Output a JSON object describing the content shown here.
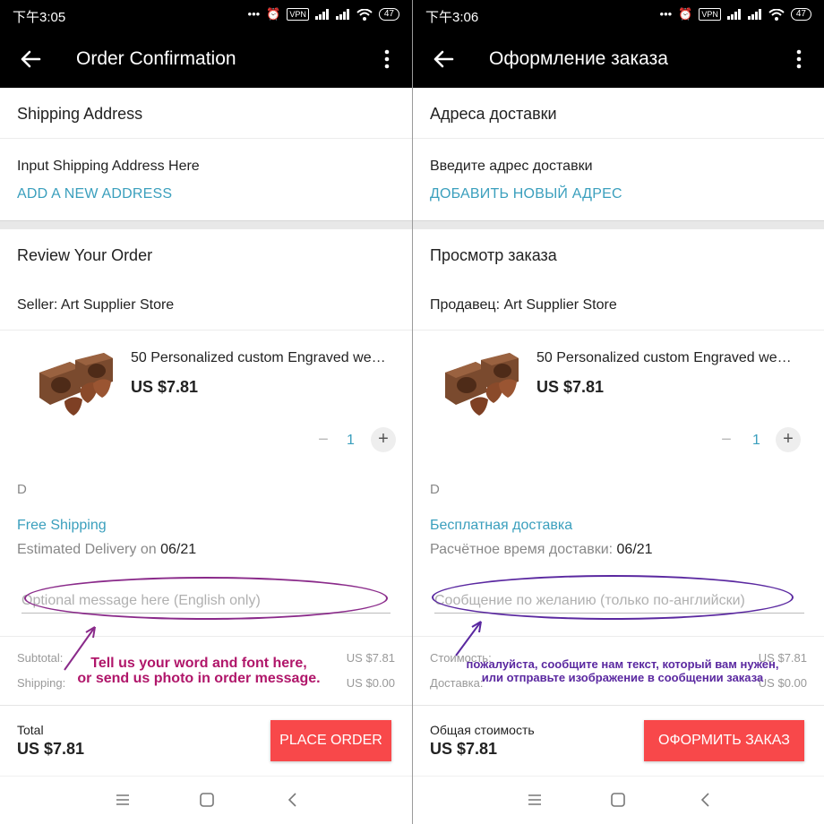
{
  "colors": {
    "accent": "#3a9fbd",
    "button": "#f8484a",
    "annotation": "#8a2a8a"
  },
  "left": {
    "status": {
      "time": "下午3:05",
      "vpn": "VPN",
      "battery": "47"
    },
    "title": "Order Confirmation",
    "shipping_header": "Shipping Address",
    "address_hint": "Input Shipping Address Here",
    "add_address": "ADD A NEW ADDRESS",
    "review_header": "Review Your Order",
    "seller_label": "Seller:",
    "seller_name": "Art Supplier Store",
    "product_name": "50 Personalized custom Engraved we…",
    "product_price": "US $7.81",
    "qty_minus": "−",
    "qty": "1",
    "qty_plus": "+",
    "variant": "D",
    "free_shipping": "Free Shipping",
    "est_label": "Estimated Delivery on",
    "est_date": "06/21",
    "message_placeholder": "Optional message here (English only)",
    "subtotal_label": "Subtotal:",
    "subtotal_value": "US $7.81",
    "shipping_label": "Shipping:",
    "shipping_value": "US $0.00",
    "total_label": "Total",
    "total_value": "US $7.81",
    "place_order": "PLACE ORDER",
    "annotation": "Tell us your word and font here,\nor send us photo in order message."
  },
  "right": {
    "status": {
      "time": "下午3:06",
      "vpn": "VPN",
      "battery": "47"
    },
    "title": "Оформление заказа",
    "shipping_header": "Адреса доставки",
    "address_hint": "Введите адрес доставки",
    "add_address": "ДОБАВИТЬ НОВЫЙ АДРЕС",
    "review_header": "Просмотр заказа",
    "seller_label": "Продавец:",
    "seller_name": "Art Supplier Store",
    "product_name": "50 Personalized custom Engraved we…",
    "product_price": "US $7.81",
    "qty_minus": "−",
    "qty": "1",
    "qty_plus": "+",
    "variant": "D",
    "free_shipping": "Бесплатная доставка",
    "est_label": "Расчётное время доставки:",
    "est_date": "06/21",
    "message_placeholder": "Сообщение по желанию (только по-английски)",
    "subtotal_label": "Стоимость:",
    "subtotal_value": "US $7.81",
    "shipping_label": "Доставка:",
    "shipping_value": "US $0.00",
    "total_label": "Общая стоимость",
    "total_value": "US $7.81",
    "place_order": "ОФОРМИТЬ ЗАКАЗ",
    "annotation": "пожалуйста, сообщите нам текст, который вам нужен,\nили отправьте изображение в сообщении заказа"
  },
  "icons": [
    "back-arrow-icon",
    "more-vertical-icon",
    "alarm-icon",
    "signal-icon",
    "wifi-icon",
    "battery-icon",
    "nav-menu-icon",
    "nav-home-icon",
    "nav-back-icon"
  ]
}
